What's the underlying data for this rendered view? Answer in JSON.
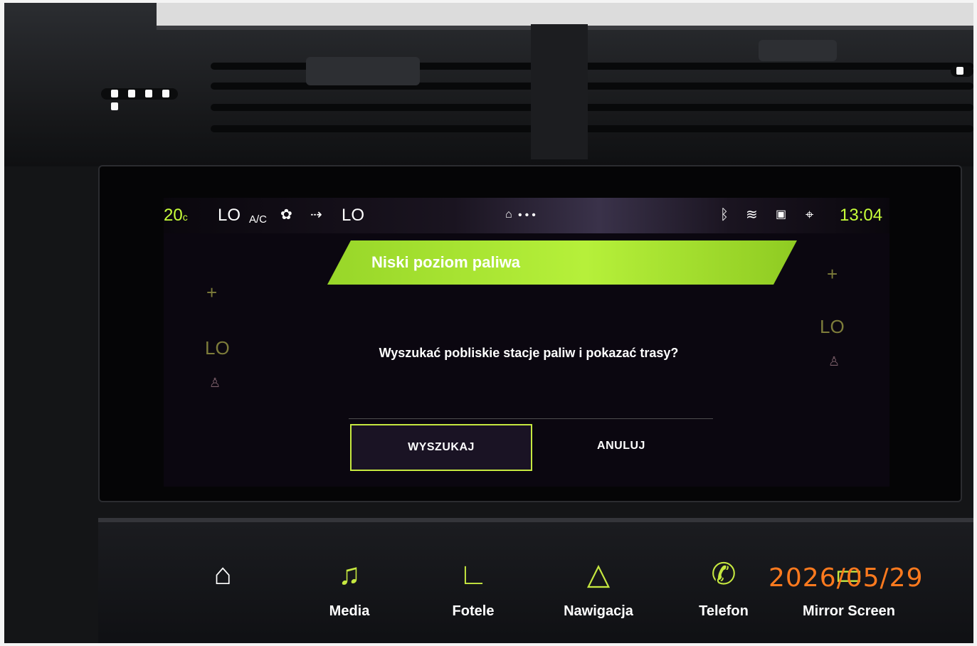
{
  "status_bar": {
    "temperature": "20",
    "temp_unit": "c",
    "fan_left": "LO",
    "ac_label": "A/C",
    "fan_right": "LO",
    "clock": "13:04"
  },
  "side_controls": {
    "left": {
      "plus": "+",
      "level": "LO"
    },
    "right": {
      "plus": "+",
      "level": "LO"
    }
  },
  "dialog": {
    "title": "Niski poziom paliwa",
    "message": "Wyszukać pobliskie stacje paliw i pokazać trasy?",
    "confirm_label": "WYSZUKAJ",
    "cancel_label": "ANULUJ"
  },
  "nav": {
    "items": [
      {
        "label": "",
        "icon": "home-icon"
      },
      {
        "label": "Media",
        "icon": "music-note-icon"
      },
      {
        "label": "Fotele",
        "icon": "seat-icon"
      },
      {
        "label": "Nawigacja",
        "icon": "navigation-arrow-icon"
      },
      {
        "label": "Telefon",
        "icon": "phone-icon"
      },
      {
        "label": "Mirror Screen",
        "icon": "mirror-screen-icon"
      }
    ]
  },
  "photo_date_stamp": "2026/05/29",
  "colors": {
    "accent": "#c6e840",
    "banner": "#b6f03a",
    "screen_bg": "#0b0710",
    "date_stamp": "#ff7a1e"
  }
}
